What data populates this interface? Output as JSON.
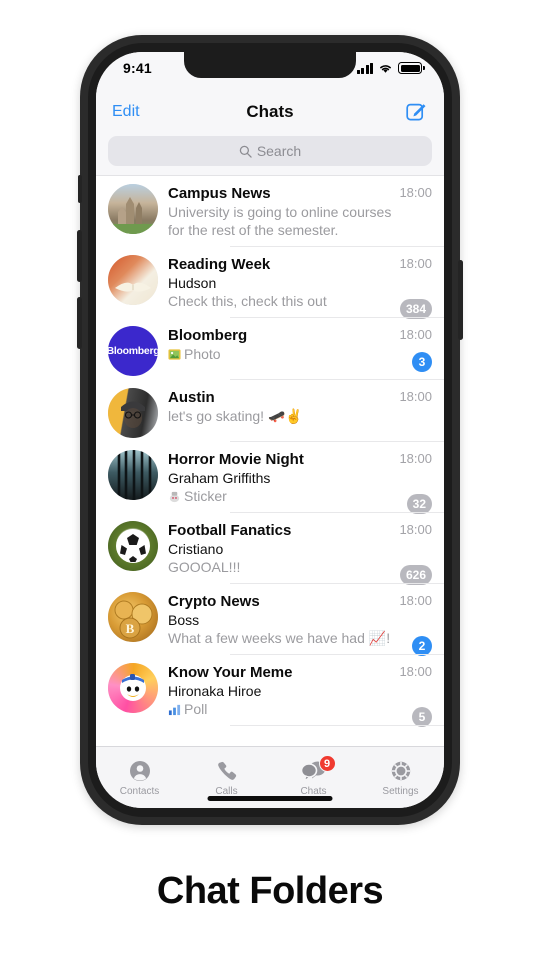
{
  "caption": "Chat Folders",
  "status_bar": {
    "time": "9:41",
    "signal_icon": "signal-bars-icon",
    "wifi_icon": "wifi-icon",
    "battery_icon": "battery-icon"
  },
  "nav": {
    "edit_label": "Edit",
    "title": "Chats",
    "compose_icon": "compose-icon"
  },
  "search": {
    "placeholder": "Search",
    "icon": "search-icon"
  },
  "colors": {
    "accent": "#2f8ef4",
    "badge_muted": "#b8b8be",
    "badge_unread": "#2f8ef4",
    "tab_badge": "#f03a30",
    "bar_bg": "#f7f7f9"
  },
  "chats": [
    {
      "title": "Campus News",
      "sender": "",
      "message": "University is going to online courses",
      "message2": "for the rest of the semester.",
      "time": "18:00",
      "badge": "",
      "badge_type": "none",
      "avatar": "cathedral-photo",
      "attachment_icon": ""
    },
    {
      "title": "Reading Week",
      "sender": "Hudson",
      "message": "Check this, check this out",
      "message2": "",
      "time": "18:00",
      "badge": "384",
      "badge_type": "muted",
      "avatar": "open-book-photo",
      "attachment_icon": ""
    },
    {
      "title": "Bloomberg",
      "sender": "",
      "message": "Photo",
      "message2": "",
      "time": "18:00",
      "badge": "3",
      "badge_type": "unread",
      "avatar": "bloomberg-logo",
      "attachment_icon": "photo-icon"
    },
    {
      "title": "Austin",
      "sender": "",
      "message": "let's go skating! 🛹✌️",
      "message2": "",
      "time": "18:00",
      "badge": "",
      "badge_type": "none",
      "avatar": "man-beanie-photo",
      "attachment_icon": ""
    },
    {
      "title": "Horror Movie Night",
      "sender": "Graham Griffiths",
      "message": "Sticker",
      "message2": "",
      "time": "18:00",
      "badge": "32",
      "badge_type": "muted",
      "avatar": "dark-forest-photo",
      "attachment_icon": "sticker-icon"
    },
    {
      "title": "Football Fanatics",
      "sender": "Cristiano",
      "message": "GOOOAL!!!",
      "message2": "",
      "time": "18:00",
      "badge": "626",
      "badge_type": "muted",
      "avatar": "soccer-ball-photo",
      "attachment_icon": ""
    },
    {
      "title": "Crypto News",
      "sender": "Boss",
      "message": "What a few weeks we have had 📈!",
      "message2": "",
      "time": "18:00",
      "badge": "2",
      "badge_type": "unread",
      "avatar": "bitcoin-coins-photo",
      "attachment_icon": ""
    },
    {
      "title": "Know Your Meme",
      "sender": "Hironaka Hiroe",
      "message": "Poll",
      "message2": "",
      "time": "18:00",
      "badge": "5",
      "badge_type": "muted",
      "avatar": "duck-meme-photo",
      "attachment_icon": "poll-icon"
    }
  ],
  "tabs": [
    {
      "label": "Contacts",
      "icon": "contacts-icon",
      "badge": ""
    },
    {
      "label": "Calls",
      "icon": "phone-icon",
      "badge": ""
    },
    {
      "label": "Chats",
      "icon": "chats-icon",
      "badge": "9"
    },
    {
      "label": "Settings",
      "icon": "gear-icon",
      "badge": ""
    }
  ]
}
